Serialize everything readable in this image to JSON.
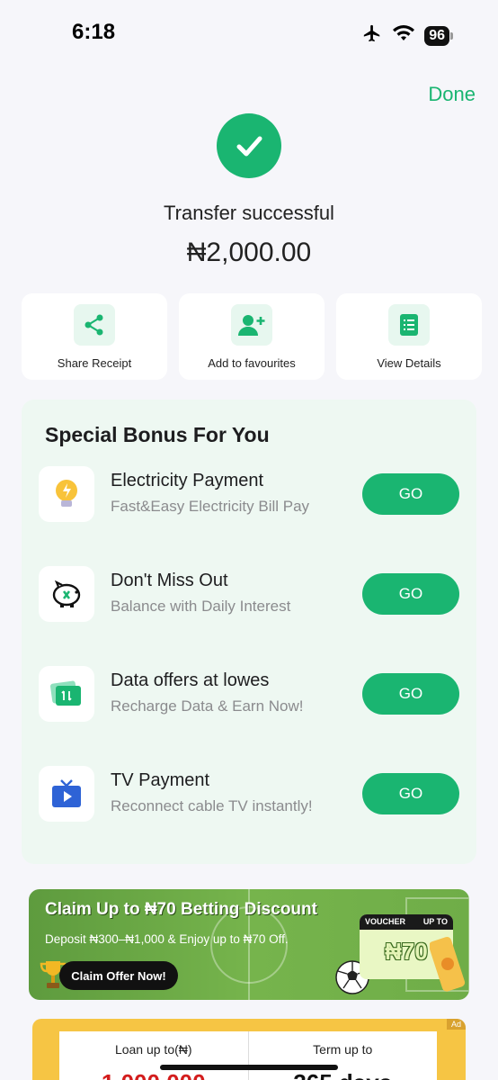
{
  "status_bar": {
    "time": "6:18",
    "battery": "96"
  },
  "header": {
    "done_label": "Done"
  },
  "result": {
    "title": "Transfer successful",
    "amount": "₦2,000.00"
  },
  "actions": [
    {
      "label": "Share Receipt",
      "icon": "share-icon"
    },
    {
      "label": "Add to favourites",
      "icon": "add-user-icon"
    },
    {
      "label": "View Details",
      "icon": "document-icon"
    }
  ],
  "bonus": {
    "title": "Special Bonus For You",
    "items": [
      {
        "name": "Electricity Payment",
        "desc": "Fast&Easy Electricity Bill Pay",
        "button": "GO",
        "icon": "lightbulb-icon"
      },
      {
        "name": "Don't Miss Out",
        "desc": "Balance with Daily Interest",
        "button": "GO",
        "icon": "piggy-bank-icon"
      },
      {
        "name": "Data offers at lowes",
        "desc": "Recharge Data & Earn Now!",
        "button": "GO",
        "icon": "data-card-icon"
      },
      {
        "name": "TV Payment",
        "desc": "Reconnect cable TV instantly!",
        "button": "GO",
        "icon": "tv-icon"
      }
    ]
  },
  "promo": {
    "title": "Claim Up to ₦70 Betting Discount",
    "subtitle": "Deposit ₦300–₦1,000 & Enjoy up to ₦70 Off.",
    "button": "Claim Offer Now!",
    "voucher_label": "VOUCHER",
    "voucher_upto": "UP TO",
    "voucher_value": "₦70"
  },
  "loan": {
    "ad_label": "Ad",
    "loan_label": "Loan up to(₦)",
    "term_label": "Term up to",
    "loan_value": "1,000,000",
    "term_value": "365 days"
  },
  "colors": {
    "accent": "#1ab571",
    "panel": "#eef8f2"
  }
}
